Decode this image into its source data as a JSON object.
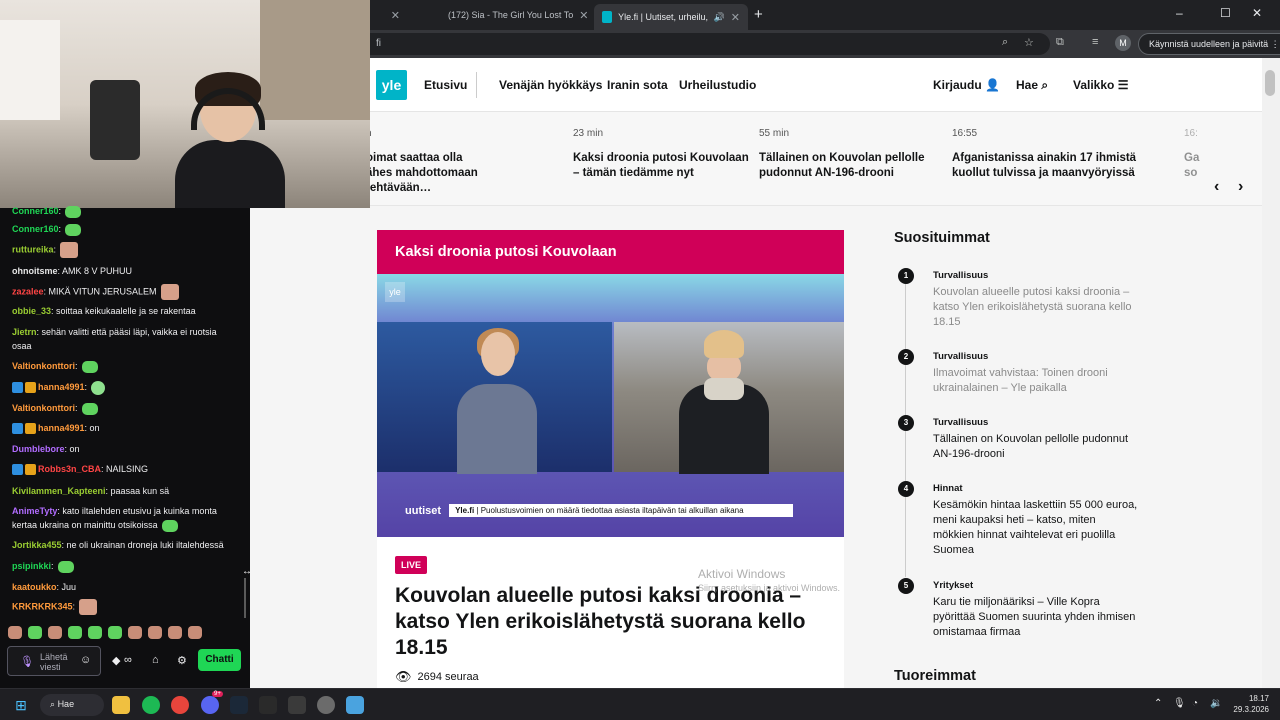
{
  "browser": {
    "tabs": [
      {
        "title": "(172) Sia - The Girl You Lost To"
      },
      {
        "title": "Yle.fi | Uutiset, urheilu, ilmi"
      }
    ],
    "address_fragment": "fi",
    "restart_button": "Käynnistä uudelleen ja päivitä",
    "profile_initial": "M",
    "window_controls": [
      "–",
      "☐",
      "✕"
    ],
    "new_tab": "+"
  },
  "yle": {
    "logo": "yle",
    "nav": [
      "Etusivu",
      "Venäjän hyökkäys",
      "Iranin sota",
      "Urheilustudio"
    ],
    "right_nav": [
      "Kirjaudu",
      "Hae",
      "Valikko"
    ],
    "ticker": [
      {
        "time": "n",
        "headline": "oimat saattaa olla\nähes mahdottomaan tehtävään…"
      },
      {
        "time": "23 min",
        "headline": "Kaksi droonia putosi Kouvolaan – tämän tiedämme nyt"
      },
      {
        "time": "55 min",
        "headline": "Tällainen on Kouvolan pellolle pudonnut AN-196-drooni"
      },
      {
        "time": "16:55",
        "headline": "Afganistanissa ainakin 17 ihmistä kuollut tulvissa ja maanvyöryissä"
      },
      {
        "time": "16:",
        "headline": "Ga\nso"
      }
    ],
    "feature": {
      "header": "Kaksi droonia putosi Kouvolaan",
      "video_logo": "yle",
      "video_brand": "uutiset",
      "video_source": "Yle.fi",
      "video_caption": "Puolustusvoimien on määrä tiedottaa asiasta iltapäivän tai alkuillan aikana",
      "live_label": "LIVE",
      "headline": "Kouvolan alueelle putosi kaksi droonia – katso Ylen erikoislähetystä suorana kello 18.15",
      "viewers": "2694 seuraa"
    },
    "popular": {
      "title": "Suosituimmat",
      "items": [
        {
          "rank": "1",
          "category": "Turvallisuus",
          "title": "Kouvolan alueelle putosi kaksi droonia – katso Ylen erikoislähetystä suorana kello 18.15",
          "dim": true
        },
        {
          "rank": "2",
          "category": "Turvallisuus",
          "title": "Ilmavoimat vahvistaa: Toinen drooni ukrainalainen – Yle paikalla",
          "dim": true
        },
        {
          "rank": "3",
          "category": "Turvallisuus",
          "title": "Tällainen on Kouvolan pellolle pudonnut AN-196-drooni",
          "dim": false
        },
        {
          "rank": "4",
          "category": "Hinnat",
          "title": "Kesämökin hintaa laskettiin 55 000 euroa, meni kaupaksi heti – katso, miten mökkien hinnat vaihtelevat eri puolilla Suomea",
          "dim": false
        },
        {
          "rank": "5",
          "category": "Yritykset",
          "title": "Karu tie miljonääriksi – Ville Kopra pyörittää Suomen suurinta yhden ihmisen omistamaa firmaa",
          "dim": false
        }
      ]
    },
    "latest_title": "Tuoreimmat",
    "activate_windows": {
      "line1": "Aktivoi Windows",
      "line2": "Siirry asetuksiin ja aktivoi Windows."
    }
  },
  "chat": {
    "messages": [
      {
        "user": "Conner160",
        "color": "#1fd655",
        "text": ":",
        "emote": "green"
      },
      {
        "user": "Conner160",
        "color": "#1fd655",
        "text": ":",
        "emote": "green"
      },
      {
        "user": "ruttureika",
        "color": "#9acd32",
        "text": ":",
        "emote": "face"
      },
      {
        "user": "ohnoitsme",
        "color": "#e6e6e6",
        "text": ": AMK 8 V PUHUU",
        "emote": ""
      },
      {
        "user": "zazalee",
        "color": "#ff4545",
        "text": ": MIKÄ VITUN JERUSALEM",
        "emote": "face"
      },
      {
        "user": "obbie_33",
        "color": "#9acd32",
        "text": ": soittaa keikukaalelle ja se rakentaa",
        "emote": ""
      },
      {
        "user": "Jietrn",
        "color": "#9acd32",
        "text": ": sehän valitti että pääsi läpi, vaikka ei ruotsia osaa",
        "emote": ""
      },
      {
        "user": "Valtionkonttori",
        "color": "#ff9a3c",
        "text": ":",
        "emote": "green"
      },
      {
        "user": "hanna4991",
        "color": "#ff9a3c",
        "text": ":",
        "emote": "pal"
      },
      {
        "user": "Valtionkonttori",
        "color": "#ff9a3c",
        "text": ":",
        "emote": "green"
      },
      {
        "user": "hanna4991",
        "color": "#ff9a3c",
        "text": ": on",
        "emote": ""
      },
      {
        "user": "Dumblebore",
        "color": "#b16cff",
        "text": ": on",
        "emote": ""
      },
      {
        "user": "Robbs3n_CBA",
        "color": "#ff4545",
        "text": ": NAILSING",
        "emote": ""
      },
      {
        "user": "Kivilammen_Kapteeni",
        "color": "#9acd32",
        "text": ": paasaa kun sä",
        "emote": ""
      },
      {
        "user": "AnimeTyty",
        "color": "#b16cff",
        "text": ": kato iltalehden etusivu ja kuinka monta kertaa ukraina on mainittu otsikoissa",
        "emote": "green"
      },
      {
        "user": "Jortikka455",
        "color": "#9acd32",
        "text": ": ne oli ukrainan droneja luki iltalehdessä",
        "emote": ""
      },
      {
        "user": "psipinkki",
        "color": "#1fd655",
        "text": ":",
        "emote": "green"
      },
      {
        "user": "kaatoukko",
        "color": "#ff9a3c",
        "text": ": Juu",
        "emote": ""
      },
      {
        "user": "KRKRKRK345",
        "color": "#ff9a3c",
        "text": ":",
        "emote": "face"
      }
    ],
    "input_placeholder": "Lähetä viesti",
    "send_label": "Chatti",
    "points": "∞"
  },
  "taskbar": {
    "search": "Hae",
    "time": "18.17",
    "date": "29.3.2026",
    "spotify_badge": "9+"
  }
}
